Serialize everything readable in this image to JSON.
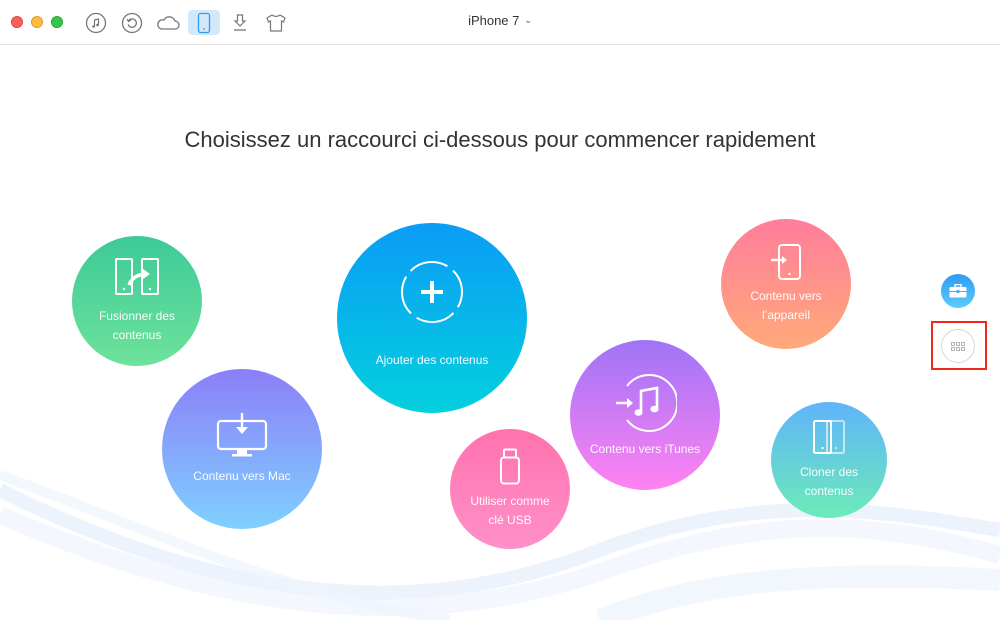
{
  "window": {
    "traffic_lights": [
      "close",
      "minimize",
      "maximize"
    ]
  },
  "toolbar": {
    "icons": [
      {
        "name": "music-icon",
        "label": "Music",
        "active": false
      },
      {
        "name": "backup-restore-icon",
        "label": "Backup",
        "active": false
      },
      {
        "name": "icloud-icon",
        "label": "iCloud",
        "active": false
      },
      {
        "name": "device-icon",
        "label": "Device",
        "active": true
      },
      {
        "name": "download-icon",
        "label": "Download",
        "active": false
      },
      {
        "name": "shirt-icon",
        "label": "Theme",
        "active": false
      }
    ],
    "active_color": "#d4e8fb",
    "device_name": "iPhone 7",
    "device_chevron": "⌄"
  },
  "main": {
    "headline": "Choisissez un raccourci ci-dessous pour commencer rapidement",
    "shortcuts": [
      {
        "id": "merge",
        "label_line1": "Fusionner des",
        "label_line2": "contenus",
        "icon": "merge-icon",
        "colors": [
          "#3cca98",
          "#6ee29b"
        ]
      },
      {
        "id": "add",
        "label_line1": "Ajouter des contenus",
        "label_line2": "",
        "icon": "add-icon",
        "colors": [
          "#0a9cf6",
          "#04d0dd"
        ]
      },
      {
        "id": "mac",
        "label_line1": "Contenu vers Mac",
        "label_line2": "",
        "icon": "mac-icon",
        "colors": [
          "#8b7ff8",
          "#7fd0ff"
        ]
      },
      {
        "id": "usb",
        "label_line1": "Utiliser comme",
        "label_line2": "clé USB",
        "icon": "usb-icon",
        "colors": [
          "#ff72ad",
          "#ff90c9"
        ]
      },
      {
        "id": "itunes",
        "label_line1": "Contenu vers iTunes",
        "label_line2": "",
        "icon": "itunes-icon",
        "colors": [
          "#9f74f7",
          "#ff82f2"
        ]
      },
      {
        "id": "device",
        "label_line1": "Contenu vers",
        "label_line2": "l’appareil",
        "icon": "to-device-icon",
        "colors": [
          "#ff7d9b",
          "#ffa97a"
        ]
      },
      {
        "id": "clone",
        "label_line1": "Cloner des",
        "label_line2": "contenus",
        "icon": "clone-icon",
        "colors": [
          "#5fb4fb",
          "#6cebb8"
        ]
      }
    ]
  },
  "sidebar": {
    "tools_button": "toolbox-icon",
    "more_button": "grid-icon",
    "highlight_color": "#ee2a1c"
  }
}
